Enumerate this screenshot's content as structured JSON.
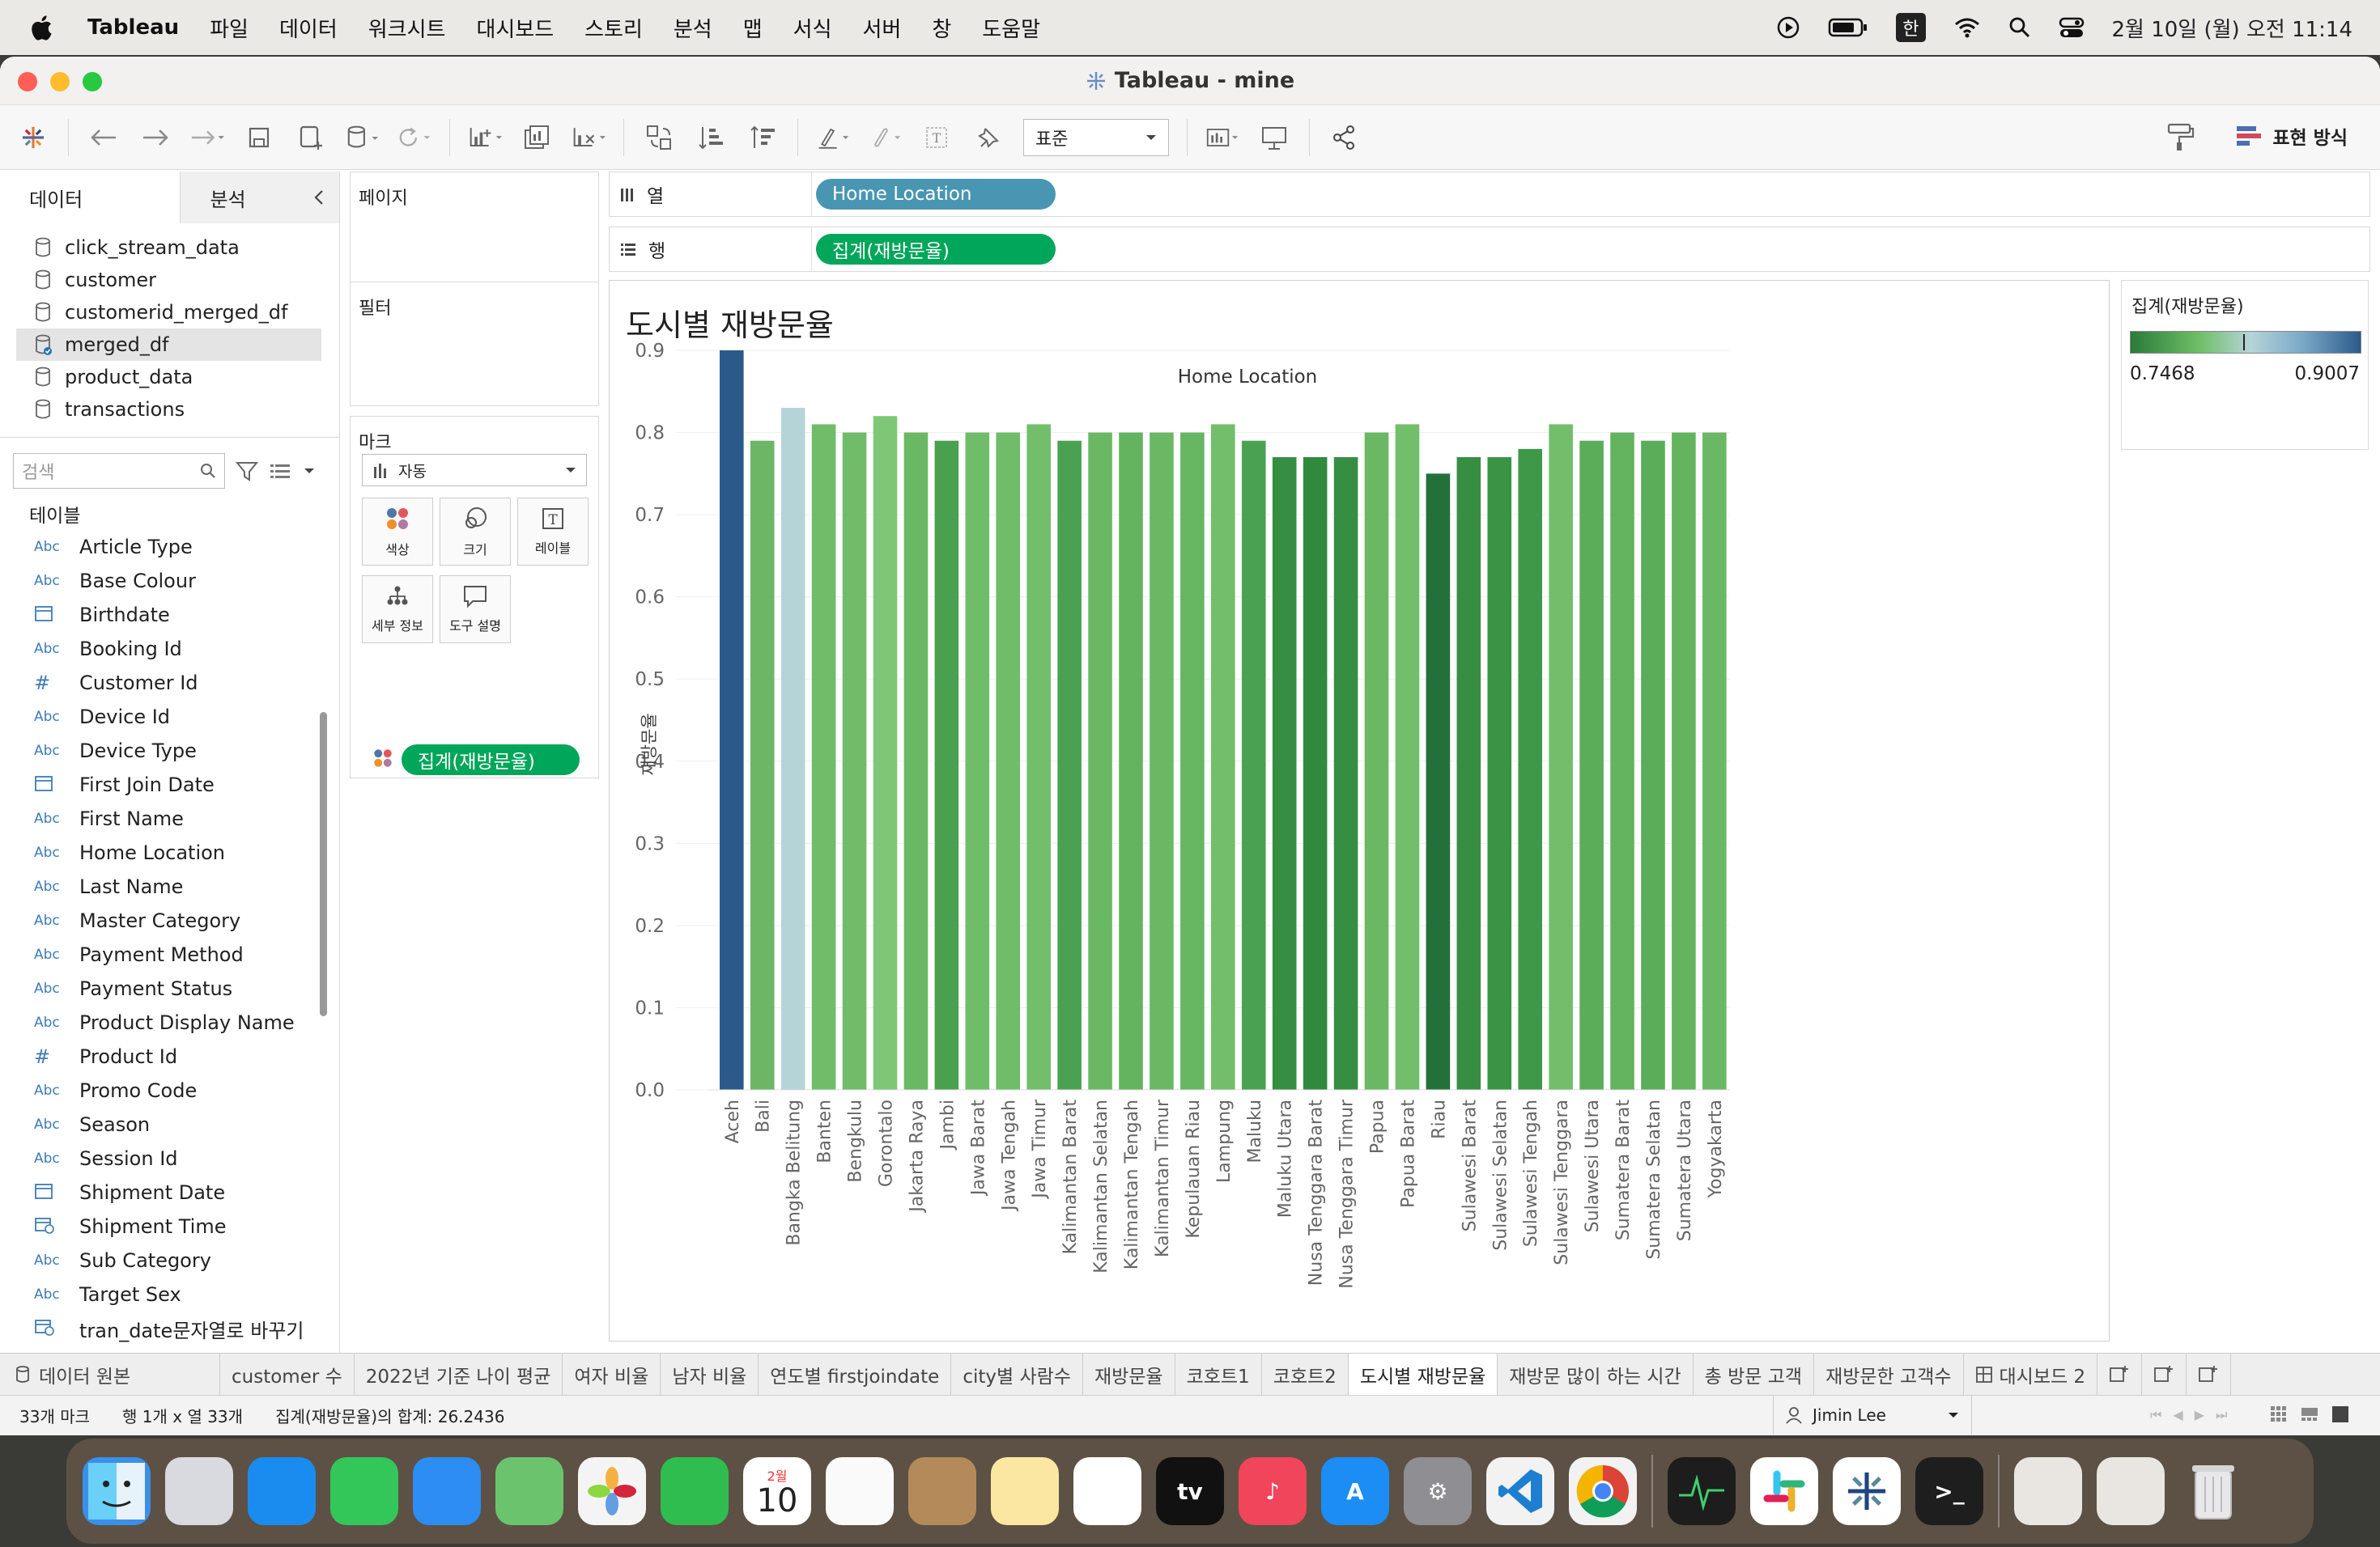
{
  "menubar": {
    "items": [
      "Tableau",
      "파일",
      "데이터",
      "워크시트",
      "대시보드",
      "스토리",
      "분석",
      "맵",
      "서식",
      "서버",
      "창",
      "도움말"
    ],
    "ime": "한",
    "clock": "2월 10일 (월) 오전 11:14"
  },
  "window": {
    "title": "Tableau - mine"
  },
  "toolbar": {
    "fit_value": "표준",
    "show_me": "표현 방식"
  },
  "left": {
    "tab_data": "데이터",
    "tab_analysis": "분석",
    "datasources": [
      "click_stream_data",
      "customer",
      "customerid_merged_df",
      "merged_df",
      "product_data",
      "transactions"
    ],
    "selected_datasource": "merged_df",
    "search_placeholder": "검색",
    "tables_header": "테이블",
    "fields": [
      {
        "type": "Abc",
        "name": "Article Type"
      },
      {
        "type": "Abc",
        "name": "Base Colour"
      },
      {
        "type": "date",
        "name": "Birthdate"
      },
      {
        "type": "Abc",
        "name": "Booking Id"
      },
      {
        "type": "#",
        "name": "Customer Id"
      },
      {
        "type": "Abc",
        "name": "Device Id"
      },
      {
        "type": "Abc",
        "name": "Device Type"
      },
      {
        "type": "date",
        "name": "First Join Date"
      },
      {
        "type": "Abc",
        "name": "First Name"
      },
      {
        "type": "Abc",
        "name": "Home Location"
      },
      {
        "type": "Abc",
        "name": "Last Name"
      },
      {
        "type": "Abc",
        "name": "Master Category"
      },
      {
        "type": "Abc",
        "name": "Payment Method"
      },
      {
        "type": "Abc",
        "name": "Payment Status"
      },
      {
        "type": "Abc",
        "name": "Product Display Name"
      },
      {
        "type": "#",
        "name": "Product Id"
      },
      {
        "type": "Abc",
        "name": "Promo Code"
      },
      {
        "type": "Abc",
        "name": "Season"
      },
      {
        "type": "Abc",
        "name": "Session Id"
      },
      {
        "type": "date",
        "name": "Shipment Date"
      },
      {
        "type": "datetime",
        "name": "Shipment Time"
      },
      {
        "type": "Abc",
        "name": "Sub Category"
      },
      {
        "type": "Abc",
        "name": "Target Sex"
      },
      {
        "type": "datetime",
        "name": "tran_date문자열로 바꾸기"
      }
    ]
  },
  "shelves": {
    "pages": "페이지",
    "filters": "필터",
    "marks": "마크",
    "marks_type": "자동",
    "mark_buttons": [
      "색상",
      "크기",
      "레이블",
      "세부 정보",
      "도구 설명"
    ],
    "marks_pill": "집계(재방문율)",
    "columns_label": "열",
    "rows_label": "행",
    "columns_pill": "Home Location",
    "rows_pill": "집계(재방문율)"
  },
  "legend": {
    "title": "집계(재방문율)",
    "min": "0.7468",
    "max": "0.9007",
    "colors": [
      "#2b7a3a",
      "#6fbf67",
      "#b5d4d8",
      "#7aa8c6",
      "#2b5a8a"
    ]
  },
  "viz": {
    "title": "도시별 재방문율"
  },
  "chart_data": {
    "type": "bar",
    "title": "Home Location",
    "xlabel": "",
    "ylabel": "재방문율",
    "ylim": [
      0,
      0.9
    ],
    "yticks": [
      "0.0",
      "0.1",
      "0.2",
      "0.3",
      "0.4",
      "0.5",
      "0.6",
      "0.7",
      "0.8",
      "0.9"
    ],
    "categories": [
      "Aceh",
      "Bali",
      "Bangka Belitung",
      "Banten",
      "Bengkulu",
      "Gorontalo",
      "Jakarta Raya",
      "Jambi",
      "Jawa Barat",
      "Jawa Tengah",
      "Jawa Timur",
      "Kalimantan Barat",
      "Kalimantan Selatan",
      "Kalimantan Tengah",
      "Kalimantan Timur",
      "Kepulauan Riau",
      "Lampung",
      "Maluku",
      "Maluku Utara",
      "Nusa Tenggara Barat",
      "Nusa Tenggara Timur",
      "Papua",
      "Papua Barat",
      "Riau",
      "Sulawesi Barat",
      "Sulawesi Selatan",
      "Sulawesi Tengah",
      "Sulawesi Tenggara",
      "Sulawesi Utara",
      "Sumatera Barat",
      "Sumatera Selatan",
      "Sumatera Utara",
      "Yogyakarta"
    ],
    "values": [
      0.9,
      0.79,
      0.83,
      0.81,
      0.8,
      0.82,
      0.8,
      0.79,
      0.8,
      0.8,
      0.81,
      0.79,
      0.8,
      0.8,
      0.8,
      0.8,
      0.81,
      0.79,
      0.77,
      0.77,
      0.77,
      0.8,
      0.81,
      0.75,
      0.77,
      0.77,
      0.78,
      0.81,
      0.79,
      0.8,
      0.79,
      0.8,
      0.8
    ],
    "colors": [
      "#2b5a8a",
      "#6db665",
      "#b5d4d8",
      "#6fbd69",
      "#71bc69",
      "#7ec776",
      "#6ab864",
      "#49a04f",
      "#6fbd69",
      "#6fbd69",
      "#72be6b",
      "#4aa151",
      "#6ab864",
      "#64b45f",
      "#6ab864",
      "#66b662",
      "#72be6b",
      "#4aa151",
      "#368e42",
      "#2f8a3e",
      "#368e42",
      "#6ab864",
      "#72be6b",
      "#24703a",
      "#368e42",
      "#3a9445",
      "#3f9848",
      "#72be6b",
      "#5cad5a",
      "#64b45f",
      "#5cad5a",
      "#64b45f",
      "#6ab864"
    ]
  },
  "sheet_tabs": [
    "데이터 원본",
    "customer 수",
    "2022년 기준 나이 평균",
    "여자 비율",
    "남자 비율",
    "연도별 firstjoindate",
    "city별 사람수",
    "재방문율",
    "코호트1",
    "코호트2",
    "도시별 재방문율",
    "재방문 많이 하는 시간",
    "총 방문 고객",
    "재방문한 고객수",
    "대시보드 2"
  ],
  "active_tab": "도시별 재방문율",
  "status": {
    "marks": "33개 마크",
    "rowcol": "행 1개 x 열 33개",
    "sum": "집계(재방문율)의 합계: 26.2436",
    "user": "Jimin Lee"
  },
  "dock": {
    "calendar_month": "2월",
    "calendar_day": "10",
    "apps": [
      "finder",
      "launchpad",
      "safari",
      "messages",
      "mail",
      "maps",
      "photos",
      "facetime",
      "calendar",
      "reminders",
      "contacts",
      "notes",
      "freeform",
      "tv",
      "music",
      "app-store",
      "system-settings",
      "vscode",
      "chrome",
      "activity-monitor",
      "slack",
      "tableau",
      "terminal"
    ]
  }
}
